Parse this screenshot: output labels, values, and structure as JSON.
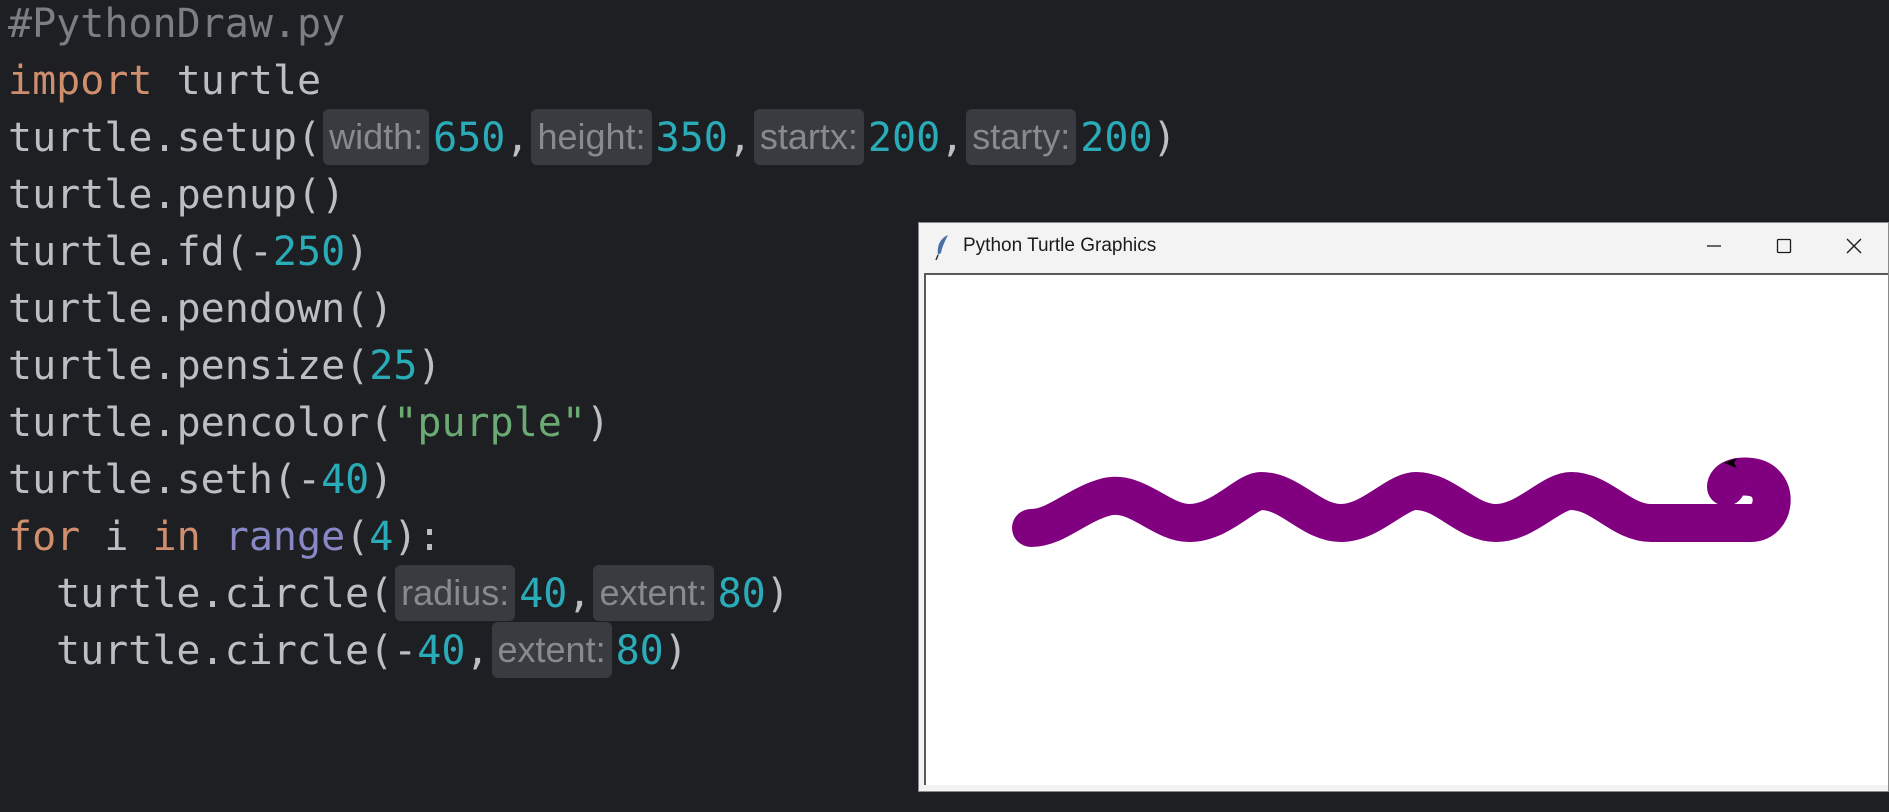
{
  "editor": {
    "lines": [
      {
        "tokens": [
          {
            "t": "#PythonDraw.py",
            "c": "comment"
          }
        ]
      },
      {
        "tokens": [
          {
            "t": "import",
            "c": "kw"
          },
          {
            "t": " turtle",
            "c": "txt"
          }
        ]
      },
      {
        "tokens": [
          {
            "t": "turtle.setup(",
            "c": "txt"
          },
          {
            "t": "width:",
            "c": "hint"
          },
          {
            "t": "650",
            "c": "num"
          },
          {
            "t": ",",
            "c": "txt"
          },
          {
            "t": "height:",
            "c": "hint"
          },
          {
            "t": "350",
            "c": "num"
          },
          {
            "t": ",",
            "c": "txt"
          },
          {
            "t": "startx:",
            "c": "hint"
          },
          {
            "t": "200",
            "c": "num"
          },
          {
            "t": ",",
            "c": "txt"
          },
          {
            "t": "starty:",
            "c": "hint"
          },
          {
            "t": "200",
            "c": "num"
          },
          {
            "t": ")",
            "c": "txt"
          }
        ]
      },
      {
        "tokens": [
          {
            "t": "turtle.penup()",
            "c": "txt"
          }
        ]
      },
      {
        "tokens": [
          {
            "t": "turtle.fd(-",
            "c": "txt"
          },
          {
            "t": "250",
            "c": "num"
          },
          {
            "t": ")",
            "c": "txt"
          }
        ]
      },
      {
        "tokens": [
          {
            "t": "turtle.pendown()",
            "c": "txt"
          }
        ]
      },
      {
        "tokens": [
          {
            "t": "turtle.pensize(",
            "c": "txt"
          },
          {
            "t": "25",
            "c": "num"
          },
          {
            "t": ")",
            "c": "txt"
          }
        ]
      },
      {
        "tokens": [
          {
            "t": "turtle.pencolor(",
            "c": "txt"
          },
          {
            "t": "\"purple\"",
            "c": "str"
          },
          {
            "t": ")",
            "c": "txt"
          }
        ]
      },
      {
        "tokens": [
          {
            "t": "turtle.seth(-",
            "c": "txt"
          },
          {
            "t": "40",
            "c": "num"
          },
          {
            "t": ")",
            "c": "txt"
          }
        ]
      },
      {
        "tokens": [
          {
            "t": "for",
            "c": "kw"
          },
          {
            "t": " i ",
            "c": "txt"
          },
          {
            "t": "in",
            "c": "kw"
          },
          {
            "t": " ",
            "c": "txt"
          },
          {
            "t": "range",
            "c": "builtin"
          },
          {
            "t": "(",
            "c": "txt"
          },
          {
            "t": "4",
            "c": "num"
          },
          {
            "t": "):",
            "c": "txt"
          }
        ]
      },
      {
        "indent": true,
        "tokens": [
          {
            "t": "turtle.circle(",
            "c": "txt"
          },
          {
            "t": "radius:",
            "c": "hint"
          },
          {
            "t": "40",
            "c": "num"
          },
          {
            "t": ",",
            "c": "txt"
          },
          {
            "t": "extent:",
            "c": "hint"
          },
          {
            "t": "80",
            "c": "num"
          },
          {
            "t": ")",
            "c": "txt"
          }
        ]
      },
      {
        "indent": true,
        "tokens": [
          {
            "t": "turtle.circle(-",
            "c": "txt"
          },
          {
            "t": "40",
            "c": "num"
          },
          {
            "t": ",",
            "c": "txt"
          },
          {
            "t": "extent:",
            "c": "hint"
          },
          {
            "t": "80",
            "c": "num"
          },
          {
            "t": ")",
            "c": "txt"
          }
        ]
      }
    ]
  },
  "turtle_window": {
    "title": "Python Turtle Graphics",
    "icons": {
      "app": "feather-icon",
      "minimize": "minimize-icon",
      "maximize": "maximize-icon",
      "close": "close-icon"
    },
    "pen_color": "#800080",
    "background": "#ffffff"
  },
  "colors": {
    "editor_bg": "#1e1f22",
    "text": "#bcbec4",
    "comment": "#7a7e85",
    "keyword": "#cf8e6d",
    "number": "#2aacb8",
    "string": "#6aab73",
    "builtin": "#8888c6",
    "hint_bg": "#393b40",
    "hint_text": "#868a91"
  }
}
